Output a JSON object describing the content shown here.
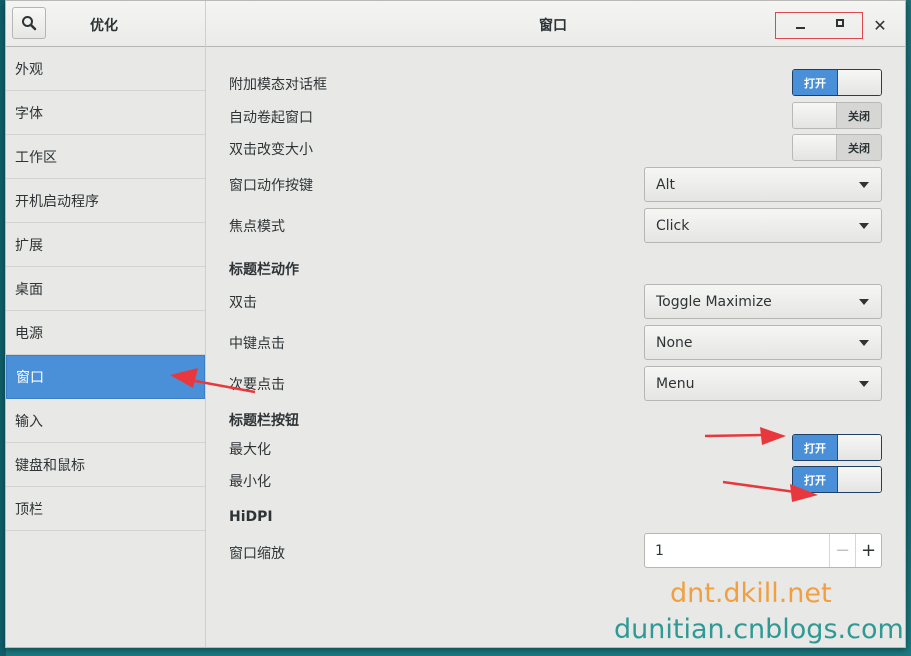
{
  "app": {
    "title": "优化",
    "page_title": "窗口",
    "close_glyph": "✕"
  },
  "sidebar": {
    "items": [
      {
        "label": "外观",
        "active": false
      },
      {
        "label": "字体",
        "active": false
      },
      {
        "label": "工作区",
        "active": false
      },
      {
        "label": "开机启动程序",
        "active": false
      },
      {
        "label": "扩展",
        "active": false
      },
      {
        "label": "桌面",
        "active": false
      },
      {
        "label": "电源",
        "active": false
      },
      {
        "label": "窗口",
        "active": true
      },
      {
        "label": "输入",
        "active": false
      },
      {
        "label": "键盘和鼠标",
        "active": false
      },
      {
        "label": "顶栏",
        "active": false
      }
    ]
  },
  "main": {
    "attach_modal": {
      "label": "附加模态对话框",
      "state": "打开",
      "on": true
    },
    "auto_raise": {
      "label": "自动卷起窗口",
      "state": "关闭",
      "on": false
    },
    "double_click_resize": {
      "label": "双击改变大小",
      "state": "关闭",
      "on": false
    },
    "action_key": {
      "label": "窗口动作按键",
      "value": "Alt"
    },
    "focus_mode": {
      "label": "焦点模式",
      "value": "Click"
    },
    "titlebar_actions": {
      "title": "标题栏动作",
      "double_click": {
        "label": "双击",
        "value": "Toggle Maximize"
      },
      "middle_click": {
        "label": "中键点击",
        "value": "None"
      },
      "secondary_click": {
        "label": "次要点击",
        "value": "Menu"
      }
    },
    "titlebar_buttons": {
      "title": "标题栏按钮",
      "maximize": {
        "label": "最大化",
        "state": "打开",
        "on": true
      },
      "minimize": {
        "label": "最小化",
        "state": "打开",
        "on": true
      }
    },
    "hidpi": {
      "title": "HiDPI",
      "scale": {
        "label": "窗口缩放",
        "value": "1",
        "minus": "−",
        "plus": "+"
      }
    }
  },
  "watermark": {
    "line1": "dnt.dkill.net",
    "line2": "dunitian.cnblogs.com"
  },
  "colors": {
    "accent": "#4a90d9",
    "annotation": "#e8383d"
  }
}
